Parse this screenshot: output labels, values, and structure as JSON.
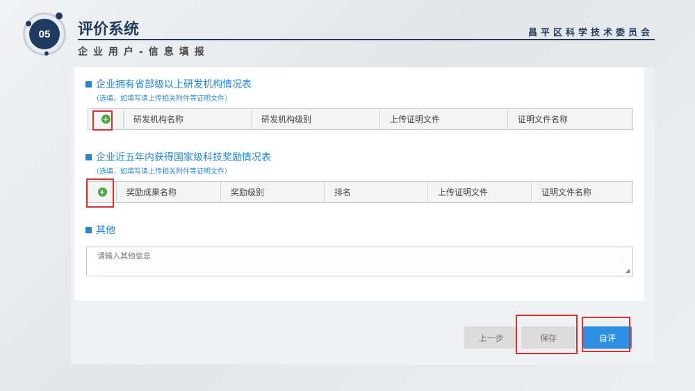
{
  "header": {
    "badge": "05",
    "title": "评价系统",
    "org": "昌平区科学技术委员会",
    "subtitle": "企业用户-信息填报"
  },
  "sections": {
    "rd": {
      "title": "企业拥有省部级以上研发机构情况表",
      "note": "（选填，如填写请上传相关附件等证明文件）",
      "columns": [
        "研发机构名称",
        "研发机构级别",
        "上传证明文件",
        "证明文件名称"
      ]
    },
    "award": {
      "title": "企业近五年内获得国家级科技奖励情况表",
      "note": "（选填，如填写请上传相关附件等证明文件）",
      "columns": [
        "奖励成果名称",
        "奖励级别",
        "排名",
        "上传证明文件",
        "证明文件名称"
      ]
    },
    "other": {
      "title": "其他",
      "placeholder": "请输入其他信息"
    }
  },
  "buttons": {
    "prev": "上一步",
    "save": "保存",
    "self_eval": "自评"
  },
  "colors": {
    "brand": "#1f3a5f",
    "accent": "#1f86d8",
    "add": "#45a842",
    "highlight": "#d9312f",
    "primary_button": "#2b8fe3"
  }
}
